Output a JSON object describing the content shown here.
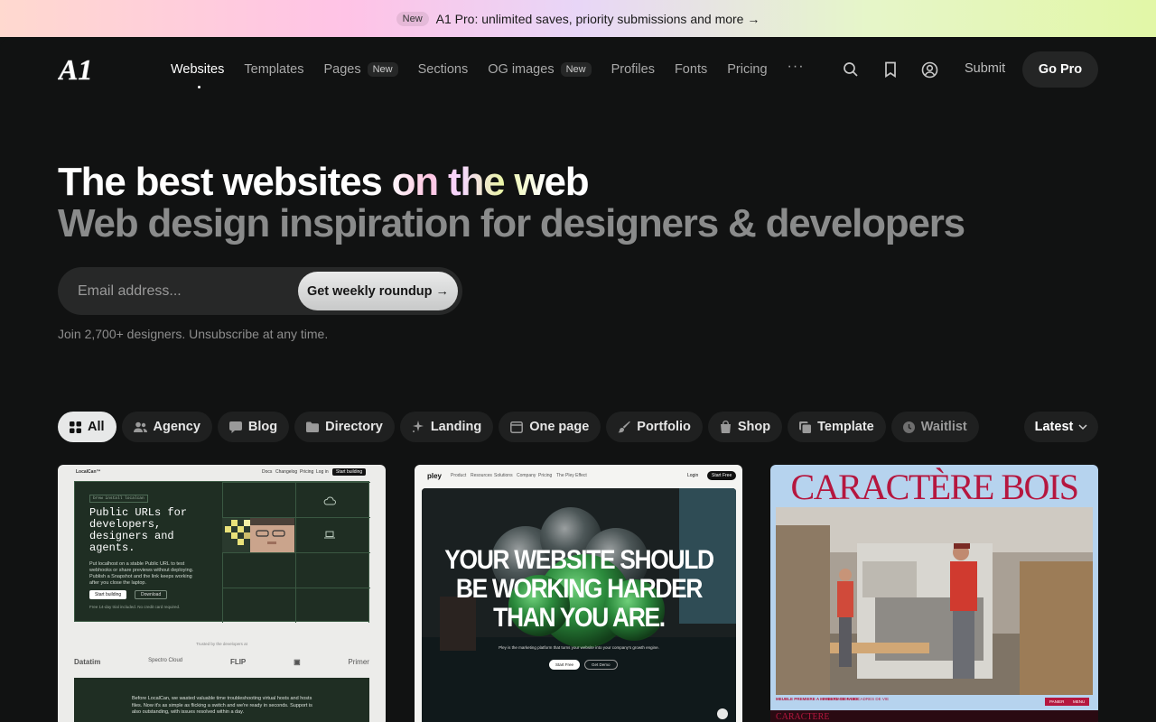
{
  "banner": {
    "badge": "New",
    "text": "A1 Pro: unlimited saves, priority submissions and more →"
  },
  "header": {
    "logo": "A1",
    "nav": [
      {
        "label": "Websites",
        "active": true
      },
      {
        "label": "Templates"
      },
      {
        "label": "Pages",
        "badge": "New"
      },
      {
        "label": "Sections"
      },
      {
        "label": "OG images",
        "badge": "New"
      },
      {
        "label": "Profiles"
      },
      {
        "label": "Fonts"
      },
      {
        "label": "Pricing"
      }
    ],
    "more": "···",
    "icons": [
      "search-icon",
      "bookmark-icon",
      "user-icon"
    ],
    "submit": "Submit",
    "cta": "Go Pro"
  },
  "hero": {
    "title": "The best websites on the web",
    "subtitle": "Web design inspiration for designers & developers",
    "email_placeholder": "Email address...",
    "roundup_button": "Get weekly roundup →",
    "note": "Join 2,700+ designers. Unsubscribe at any time."
  },
  "filters": {
    "chips": [
      {
        "label": "All",
        "icon": "grid-icon",
        "active": true
      },
      {
        "label": "Agency",
        "icon": "users-icon"
      },
      {
        "label": "Blog",
        "icon": "chat-icon"
      },
      {
        "label": "Directory",
        "icon": "folder-icon"
      },
      {
        "label": "Landing",
        "icon": "sparkle-icon"
      },
      {
        "label": "One page",
        "icon": "page-icon"
      },
      {
        "label": "Portfolio",
        "icon": "brush-icon"
      },
      {
        "label": "Shop",
        "icon": "bag-icon"
      },
      {
        "label": "Template",
        "icon": "copy-icon"
      },
      {
        "label": "Waitlist",
        "icon": "clock-icon"
      }
    ],
    "sort": "Latest"
  },
  "cards": {
    "localcan": {
      "brand": "LocalCan™",
      "nav": [
        "Docs",
        "Changelog",
        "Pricing",
        "Log in"
      ],
      "nav_cta": "Start building",
      "tag": "brew install localcan",
      "title": "Public URLs for developers, designers and agents.",
      "body": "Put localhost on a stable Public URL to test webhooks or share previews without deploying. Publish a Snapshot and the link keeps working after you close the laptop.",
      "cta1": "Start building",
      "cta2": "Download",
      "free": "Free 14-day trial included. No credit card required.",
      "trusted": "Trusted by the developers at",
      "logos": [
        "Datatim",
        "Spectro Cloud",
        "FLIP",
        "▣",
        "Primer"
      ],
      "quote": "Before LocalCan, we wasted valuable time troubleshooting virtual hosts and hosts files. Now it's as simple as flicking a switch and we're ready in seconds. Support is also outstanding, with issues resolved within a day."
    },
    "pley": {
      "brand": "pley",
      "nav": [
        "Product",
        "Resources",
        "Solutions",
        "Company",
        "Pricing",
        "The Pley Effect"
      ],
      "login": "Login",
      "nav_cta": "Start Free",
      "headline": "YOUR WEBSITE SHOULD BE WORKING HARDER THAN YOU ARE.",
      "sub": "Pley is the marketing platform that turns your website into your company's growth engine.",
      "cta1": "Start Free",
      "cta2": "Get Demo"
    },
    "caractere": {
      "title": "CARACTÈRE BOIS",
      "cap1": "MEUBLE PREMIERE A MANIERE DE FAIRE",
      "cap2": "FABRICATION DE CADRES DE VIE",
      "btn1": "PANIER",
      "btn2": "MENU",
      "foot": "CARACTERE"
    }
  },
  "colors": {
    "bg": "#111212",
    "chip": "#1f2020",
    "accent_wood": "#b5173f"
  }
}
